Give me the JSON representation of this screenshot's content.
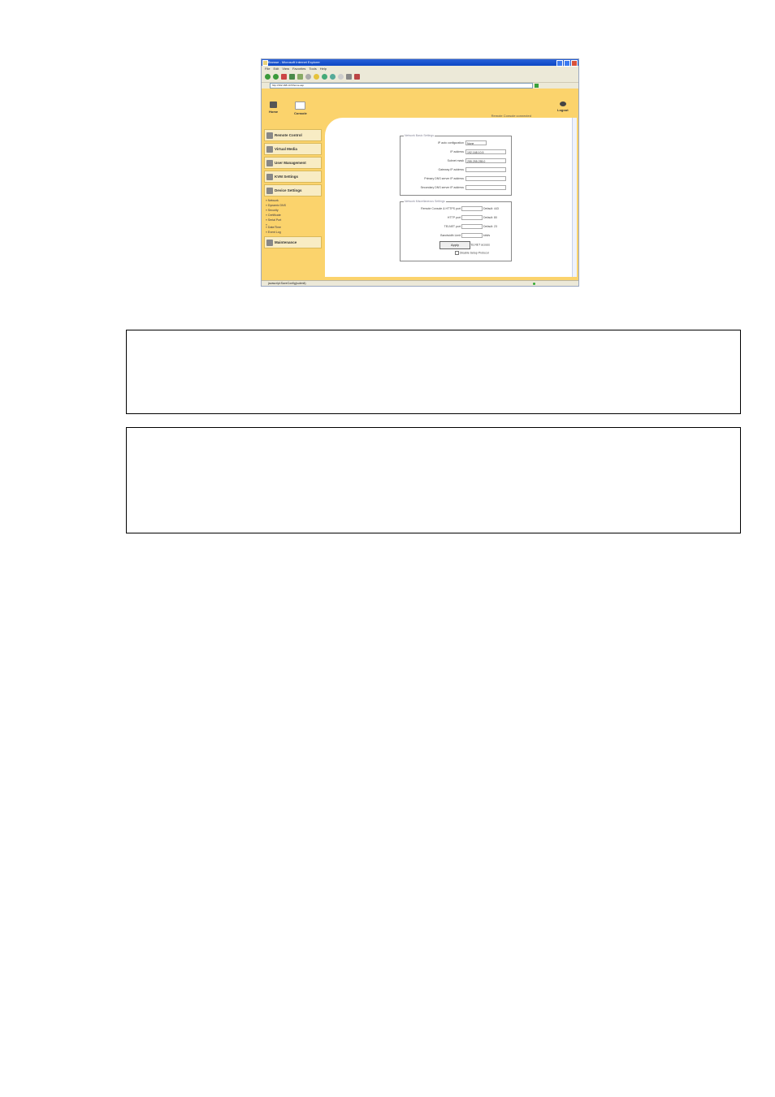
{
  "browser": {
    "title": "Browse - Microsoft Internet Explorer",
    "menu": [
      "File",
      "Edit",
      "View",
      "Favorites",
      "Tools",
      "Help"
    ],
    "address": "http://192.168.10.5/home.asp",
    "status": "javascript:SaveConfig(submit)"
  },
  "topnav": {
    "home": "Home",
    "console": "Console",
    "logout": "Logout",
    "status": "Remote Console connected"
  },
  "sidebar": {
    "items": [
      {
        "label": "Remote Control"
      },
      {
        "label": "Virtual Media"
      },
      {
        "label": "User Management"
      },
      {
        "label": "KVM Settings"
      },
      {
        "label": "Device Settings"
      }
    ],
    "sub_items": [
      "Network",
      "Dynamic DNS",
      "Security",
      "Certificate",
      "Serial Port"
    ],
    "sub_items2": [
      "Date/Time",
      "Event Log"
    ],
    "maintenance": "Maintenance"
  },
  "network_basic": {
    "legend": "Network Basic Settings",
    "rows": [
      {
        "label": "IP auto configuration",
        "value": "None"
      },
      {
        "label": "IP address",
        "value": "192.168.10.5"
      },
      {
        "label": "Subnet mask",
        "value": "255.255.255.0"
      },
      {
        "label": "Gateway IP address",
        "value": ""
      },
      {
        "label": "Primary DNS server IP address",
        "value": ""
      },
      {
        "label": "Secondary DNS server IP address",
        "value": ""
      }
    ]
  },
  "network_misc": {
    "legend": "Network Miscellaneous Settings",
    "rows": [
      {
        "label": "Remote Console & HTTPS port",
        "value": "",
        "default": "Default: 443"
      },
      {
        "label": "HTTP port",
        "value": "",
        "default": "Default: 80"
      },
      {
        "label": "TELNET port",
        "value": "",
        "default": "Default: 23"
      },
      {
        "label": "Bandwidth Limit",
        "value": "",
        "default": "kbit/s"
      }
    ],
    "checkboxes": [
      "Enable TELNET access",
      "Disable Setup Protocol"
    ]
  },
  "apply_label": "Apply"
}
